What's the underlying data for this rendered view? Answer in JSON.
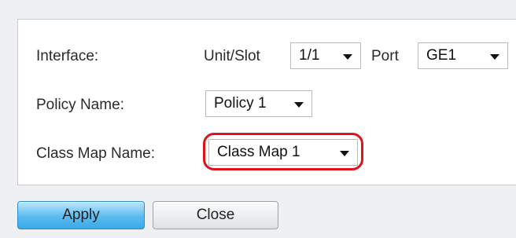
{
  "form": {
    "interface_label": "Interface:",
    "unit_slot_label": "Unit/Slot",
    "unit_slot_value": "1/1",
    "port_label": "Port",
    "port_value": "GE1",
    "policy_name_label": "Policy Name:",
    "policy_name_value": "Policy 1",
    "class_map_name_label": "Class Map Name:",
    "class_map_name_value": "Class Map 1"
  },
  "actions": {
    "apply_label": "Apply",
    "close_label": "Close"
  },
  "colors": {
    "highlight": "#e0121b",
    "apply_button": "#5bbcf0"
  },
  "icons": {
    "dropdown": "chevron-down-icon"
  }
}
